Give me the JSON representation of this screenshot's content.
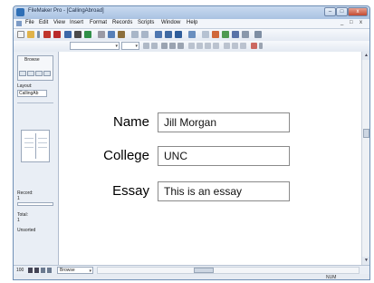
{
  "window": {
    "title": "FileMaker Pro - [CallingAbroad]",
    "controls": {
      "minimize": "–",
      "maximize": "□",
      "close": "x"
    }
  },
  "menubar": {
    "items": [
      "File",
      "Edit",
      "View",
      "Insert",
      "Format",
      "Records",
      "Scripts",
      "Window",
      "Help"
    ],
    "doc_controls": [
      "_",
      "□",
      "x"
    ]
  },
  "status_area": {
    "mode_label": "Browse",
    "layout_label": "Layout:",
    "layout_value": "CallingAb",
    "record_label": "Record:",
    "record_value": "1",
    "total_label": "Total:",
    "total_value": "1",
    "sort_status": "Unsorted"
  },
  "form": {
    "fields": [
      {
        "label": "Name",
        "value": "Jill Morgan"
      },
      {
        "label": "College",
        "value": "UNC"
      },
      {
        "label": "Essay",
        "value": "This is an essay"
      }
    ]
  },
  "bottom": {
    "zoom": "100",
    "mode": "Browse"
  },
  "statusbar": {
    "num": "NUM"
  }
}
